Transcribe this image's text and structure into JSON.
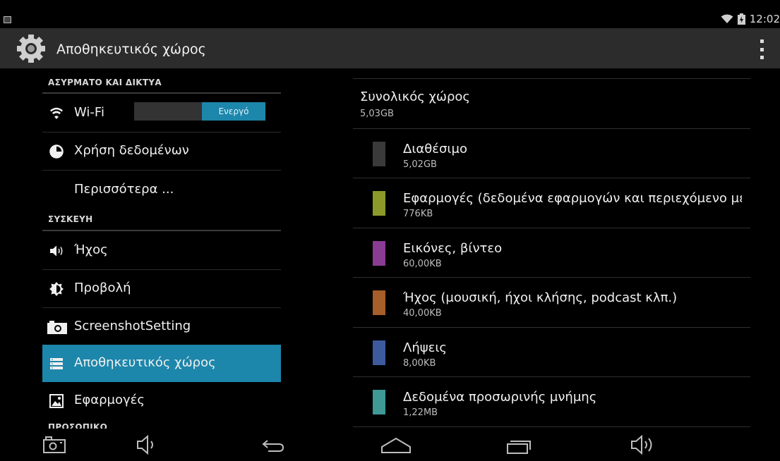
{
  "status_bar": {
    "time": "12:02"
  },
  "action_bar": {
    "title": "Αποθηκευτικός χώρος"
  },
  "left_pane": {
    "section_wireless": "ΑΣΥΡΜΑΤΟ ΚΑΙ ΔΙΚΤΥΑ",
    "wifi_label": "Wi-Fi",
    "wifi_toggle": "Ενεργό",
    "data_usage": "Χρήση δεδομένων",
    "more": "Περισσότερα ...",
    "section_device": "ΣΥΣΚΕΥΗ",
    "sound": "Ήχος",
    "display": "Προβολή",
    "screenshot": "ScreenshotSetting",
    "storage": "Αποθηκευτικός χώρος",
    "apps": "Εφαρμογές",
    "section_personal": "ΠΡΟΣΩΠΙΚΟ"
  },
  "storage": {
    "total_label": "Συνολικός χώρος",
    "total_value": "5,03GB",
    "items": [
      {
        "label": "Διαθέσιμο",
        "size": "5,02GB",
        "color": "#3a3a3a"
      },
      {
        "label": "Εφαρμογές (δεδομένα εφαρμογών και περιεχόμενο μέσων)",
        "size": "776KB",
        "color": "#8c9a2a"
      },
      {
        "label": "Εικόνες, βίντεο",
        "size": "60,00KB",
        "color": "#8a3b93"
      },
      {
        "label": "Ήχος (μουσική, ήχοι κλήσης, podcast κλπ.)",
        "size": "40,00KB",
        "color": "#a65e2b"
      },
      {
        "label": "Λήψεις",
        "size": "8,00KB",
        "color": "#3e5a9e"
      },
      {
        "label": "Δεδομένα προσωρινής μνήμης",
        "size": "1,22MB",
        "color": "#3f9a96"
      }
    ]
  },
  "icons": {
    "wifi": "wifi-icon",
    "data_usage": "data-usage-icon",
    "sound": "speaker-icon",
    "display": "brightness-icon",
    "screenshot": "camera-icon",
    "storage": "storage-icon",
    "apps": "apps-icon"
  }
}
